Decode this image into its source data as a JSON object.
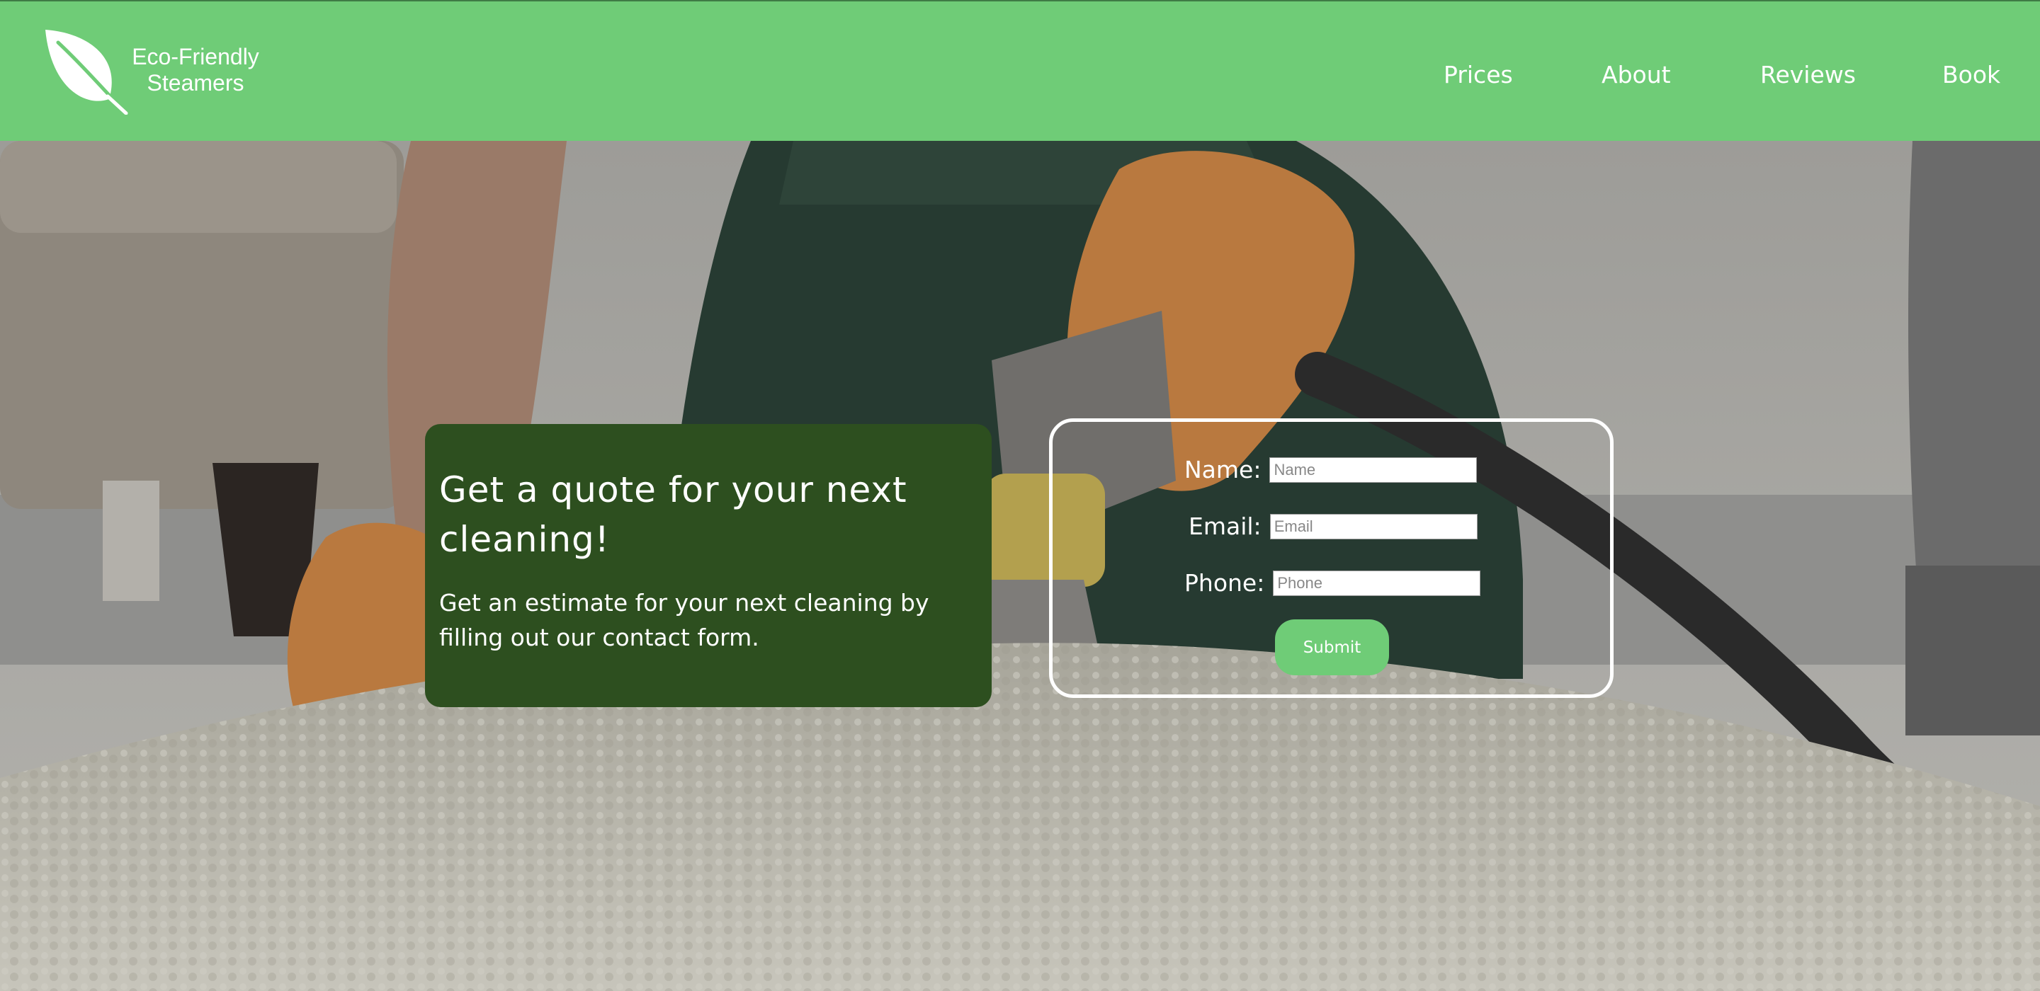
{
  "brand": {
    "name_line1": "Eco-Friendly",
    "name_line2": "Steamers",
    "logo_icon": "leaf-icon"
  },
  "nav": [
    {
      "label": "Prices"
    },
    {
      "label": "About"
    },
    {
      "label": "Reviews"
    },
    {
      "label": "Book"
    }
  ],
  "hero": {
    "background": "photo-carpet-steam-cleaning",
    "quote_title": "Get a quote for your next cleaning!",
    "quote_text": "Get an estimate for your next cleaning by filling out our contact form."
  },
  "form": {
    "name": {
      "label": "Name:",
      "placeholder": "Name",
      "value": ""
    },
    "email": {
      "label": "Email:",
      "placeholder": "Email",
      "value": ""
    },
    "phone": {
      "label": "Phone:",
      "placeholder": "Phone",
      "value": ""
    },
    "submit_label": "Submit"
  },
  "colors": {
    "header": "#6fcc77",
    "card": "#2d4f1f",
    "submit": "#6fcc77",
    "text": "#ffffff"
  }
}
